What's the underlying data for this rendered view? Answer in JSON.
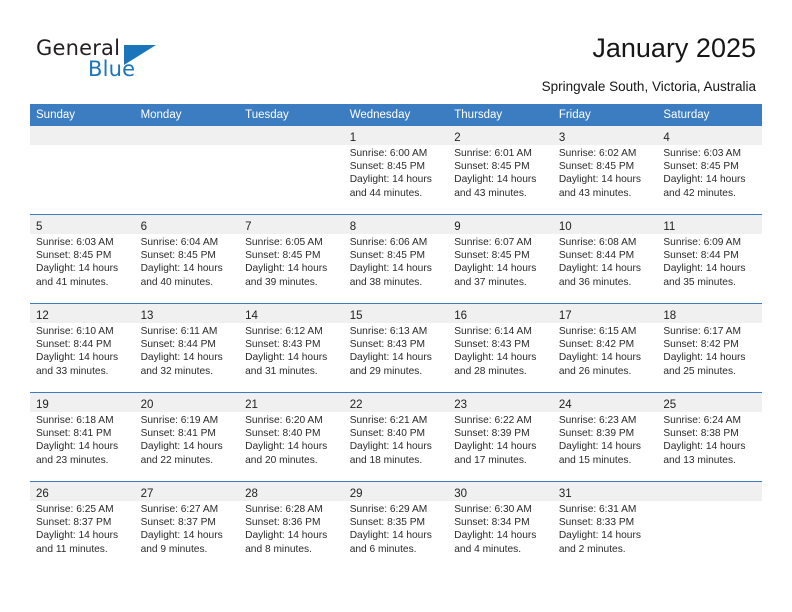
{
  "brand": {
    "name_part1": "General",
    "name_part2": "Blue"
  },
  "header": {
    "title": "January 2025",
    "location": "Springvale South, Victoria, Australia"
  },
  "colors": {
    "header_band": "#3b7dc0",
    "date_band": "#f0f0f0",
    "brand_blue": "#1b75bb"
  },
  "calendar": {
    "weekday_headers": [
      "Sunday",
      "Monday",
      "Tuesday",
      "Wednesday",
      "Thursday",
      "Friday",
      "Saturday"
    ],
    "weeks": [
      [
        {
          "day": "",
          "sunrise": "",
          "sunset": "",
          "daylight1": "",
          "daylight2": "",
          "empty": true
        },
        {
          "day": "",
          "sunrise": "",
          "sunset": "",
          "daylight1": "",
          "daylight2": "",
          "empty": true
        },
        {
          "day": "",
          "sunrise": "",
          "sunset": "",
          "daylight1": "",
          "daylight2": "",
          "empty": true
        },
        {
          "day": "1",
          "sunrise": "Sunrise: 6:00 AM",
          "sunset": "Sunset: 8:45 PM",
          "daylight1": "Daylight: 14 hours",
          "daylight2": "and 44 minutes."
        },
        {
          "day": "2",
          "sunrise": "Sunrise: 6:01 AM",
          "sunset": "Sunset: 8:45 PM",
          "daylight1": "Daylight: 14 hours",
          "daylight2": "and 43 minutes."
        },
        {
          "day": "3",
          "sunrise": "Sunrise: 6:02 AM",
          "sunset": "Sunset: 8:45 PM",
          "daylight1": "Daylight: 14 hours",
          "daylight2": "and 43 minutes."
        },
        {
          "day": "4",
          "sunrise": "Sunrise: 6:03 AM",
          "sunset": "Sunset: 8:45 PM",
          "daylight1": "Daylight: 14 hours",
          "daylight2": "and 42 minutes."
        }
      ],
      [
        {
          "day": "5",
          "sunrise": "Sunrise: 6:03 AM",
          "sunset": "Sunset: 8:45 PM",
          "daylight1": "Daylight: 14 hours",
          "daylight2": "and 41 minutes."
        },
        {
          "day": "6",
          "sunrise": "Sunrise: 6:04 AM",
          "sunset": "Sunset: 8:45 PM",
          "daylight1": "Daylight: 14 hours",
          "daylight2": "and 40 minutes."
        },
        {
          "day": "7",
          "sunrise": "Sunrise: 6:05 AM",
          "sunset": "Sunset: 8:45 PM",
          "daylight1": "Daylight: 14 hours",
          "daylight2": "and 39 minutes."
        },
        {
          "day": "8",
          "sunrise": "Sunrise: 6:06 AM",
          "sunset": "Sunset: 8:45 PM",
          "daylight1": "Daylight: 14 hours",
          "daylight2": "and 38 minutes."
        },
        {
          "day": "9",
          "sunrise": "Sunrise: 6:07 AM",
          "sunset": "Sunset: 8:45 PM",
          "daylight1": "Daylight: 14 hours",
          "daylight2": "and 37 minutes."
        },
        {
          "day": "10",
          "sunrise": "Sunrise: 6:08 AM",
          "sunset": "Sunset: 8:44 PM",
          "daylight1": "Daylight: 14 hours",
          "daylight2": "and 36 minutes."
        },
        {
          "day": "11",
          "sunrise": "Sunrise: 6:09 AM",
          "sunset": "Sunset: 8:44 PM",
          "daylight1": "Daylight: 14 hours",
          "daylight2": "and 35 minutes."
        }
      ],
      [
        {
          "day": "12",
          "sunrise": "Sunrise: 6:10 AM",
          "sunset": "Sunset: 8:44 PM",
          "daylight1": "Daylight: 14 hours",
          "daylight2": "and 33 minutes."
        },
        {
          "day": "13",
          "sunrise": "Sunrise: 6:11 AM",
          "sunset": "Sunset: 8:44 PM",
          "daylight1": "Daylight: 14 hours",
          "daylight2": "and 32 minutes."
        },
        {
          "day": "14",
          "sunrise": "Sunrise: 6:12 AM",
          "sunset": "Sunset: 8:43 PM",
          "daylight1": "Daylight: 14 hours",
          "daylight2": "and 31 minutes."
        },
        {
          "day": "15",
          "sunrise": "Sunrise: 6:13 AM",
          "sunset": "Sunset: 8:43 PM",
          "daylight1": "Daylight: 14 hours",
          "daylight2": "and 29 minutes."
        },
        {
          "day": "16",
          "sunrise": "Sunrise: 6:14 AM",
          "sunset": "Sunset: 8:43 PM",
          "daylight1": "Daylight: 14 hours",
          "daylight2": "and 28 minutes."
        },
        {
          "day": "17",
          "sunrise": "Sunrise: 6:15 AM",
          "sunset": "Sunset: 8:42 PM",
          "daylight1": "Daylight: 14 hours",
          "daylight2": "and 26 minutes."
        },
        {
          "day": "18",
          "sunrise": "Sunrise: 6:17 AM",
          "sunset": "Sunset: 8:42 PM",
          "daylight1": "Daylight: 14 hours",
          "daylight2": "and 25 minutes."
        }
      ],
      [
        {
          "day": "19",
          "sunrise": "Sunrise: 6:18 AM",
          "sunset": "Sunset: 8:41 PM",
          "daylight1": "Daylight: 14 hours",
          "daylight2": "and 23 minutes."
        },
        {
          "day": "20",
          "sunrise": "Sunrise: 6:19 AM",
          "sunset": "Sunset: 8:41 PM",
          "daylight1": "Daylight: 14 hours",
          "daylight2": "and 22 minutes."
        },
        {
          "day": "21",
          "sunrise": "Sunrise: 6:20 AM",
          "sunset": "Sunset: 8:40 PM",
          "daylight1": "Daylight: 14 hours",
          "daylight2": "and 20 minutes."
        },
        {
          "day": "22",
          "sunrise": "Sunrise: 6:21 AM",
          "sunset": "Sunset: 8:40 PM",
          "daylight1": "Daylight: 14 hours",
          "daylight2": "and 18 minutes."
        },
        {
          "day": "23",
          "sunrise": "Sunrise: 6:22 AM",
          "sunset": "Sunset: 8:39 PM",
          "daylight1": "Daylight: 14 hours",
          "daylight2": "and 17 minutes."
        },
        {
          "day": "24",
          "sunrise": "Sunrise: 6:23 AM",
          "sunset": "Sunset: 8:39 PM",
          "daylight1": "Daylight: 14 hours",
          "daylight2": "and 15 minutes."
        },
        {
          "day": "25",
          "sunrise": "Sunrise: 6:24 AM",
          "sunset": "Sunset: 8:38 PM",
          "daylight1": "Daylight: 14 hours",
          "daylight2": "and 13 minutes."
        }
      ],
      [
        {
          "day": "26",
          "sunrise": "Sunrise: 6:25 AM",
          "sunset": "Sunset: 8:37 PM",
          "daylight1": "Daylight: 14 hours",
          "daylight2": "and 11 minutes."
        },
        {
          "day": "27",
          "sunrise": "Sunrise: 6:27 AM",
          "sunset": "Sunset: 8:37 PM",
          "daylight1": "Daylight: 14 hours",
          "daylight2": "and 9 minutes."
        },
        {
          "day": "28",
          "sunrise": "Sunrise: 6:28 AM",
          "sunset": "Sunset: 8:36 PM",
          "daylight1": "Daylight: 14 hours",
          "daylight2": "and 8 minutes."
        },
        {
          "day": "29",
          "sunrise": "Sunrise: 6:29 AM",
          "sunset": "Sunset: 8:35 PM",
          "daylight1": "Daylight: 14 hours",
          "daylight2": "and 6 minutes."
        },
        {
          "day": "30",
          "sunrise": "Sunrise: 6:30 AM",
          "sunset": "Sunset: 8:34 PM",
          "daylight1": "Daylight: 14 hours",
          "daylight2": "and 4 minutes."
        },
        {
          "day": "31",
          "sunrise": "Sunrise: 6:31 AM",
          "sunset": "Sunset: 8:33 PM",
          "daylight1": "Daylight: 14 hours",
          "daylight2": "and 2 minutes."
        },
        {
          "day": "",
          "sunrise": "",
          "sunset": "",
          "daylight1": "",
          "daylight2": "",
          "empty": true
        }
      ]
    ]
  }
}
